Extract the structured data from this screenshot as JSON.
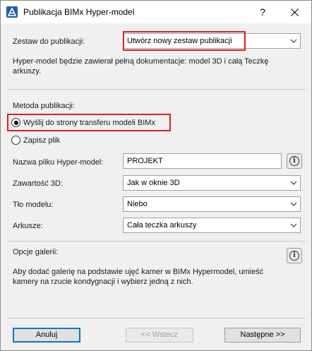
{
  "window": {
    "title": "Publikacja BIMx Hyper-model",
    "help_label": "?",
    "close_icon": "close-icon",
    "app_icon": "archicad-icon"
  },
  "publish_set": {
    "label": "Zestaw do publikacji:",
    "selected": "Utwórz nowy zestaw publikacji",
    "description_line1": "Hyper-model będzie zawierał pełną dokumentacje: model 3D i całą Teczkę",
    "description_line2": "arkuszy."
  },
  "method": {
    "heading": "Metoda publikacji:",
    "option_transfer": "Wyślij do strony transferu modeli BIMx",
    "option_save": "Zapisz plik",
    "selected": "option_transfer"
  },
  "form": {
    "filename_label": "Nazwa pliku Hyper-model:",
    "filename_value": "PROJEKT",
    "content3d_label": "Zawartość 3D:",
    "content3d_value": "Jak w oknie 3D",
    "background_label": "Tło modelu:",
    "background_value": "Niebo",
    "sheets_label": "Arkusze:",
    "sheets_value": "Cała teczka arkuszy"
  },
  "gallery": {
    "heading": "Opcje galerii:",
    "text_line1": "Aby dodać galerię na podstawie ujęć kamer w BIMx Hypermodel, umieść",
    "text_line2": "kamery na rzucie kondygnacji i wybierz jedną z nich."
  },
  "buttons": {
    "cancel": "Anuluj",
    "back": "<< Wstecz",
    "next": "Następne >>"
  },
  "colors": {
    "highlight": "#e02020",
    "primary_border": "#0078d7"
  }
}
